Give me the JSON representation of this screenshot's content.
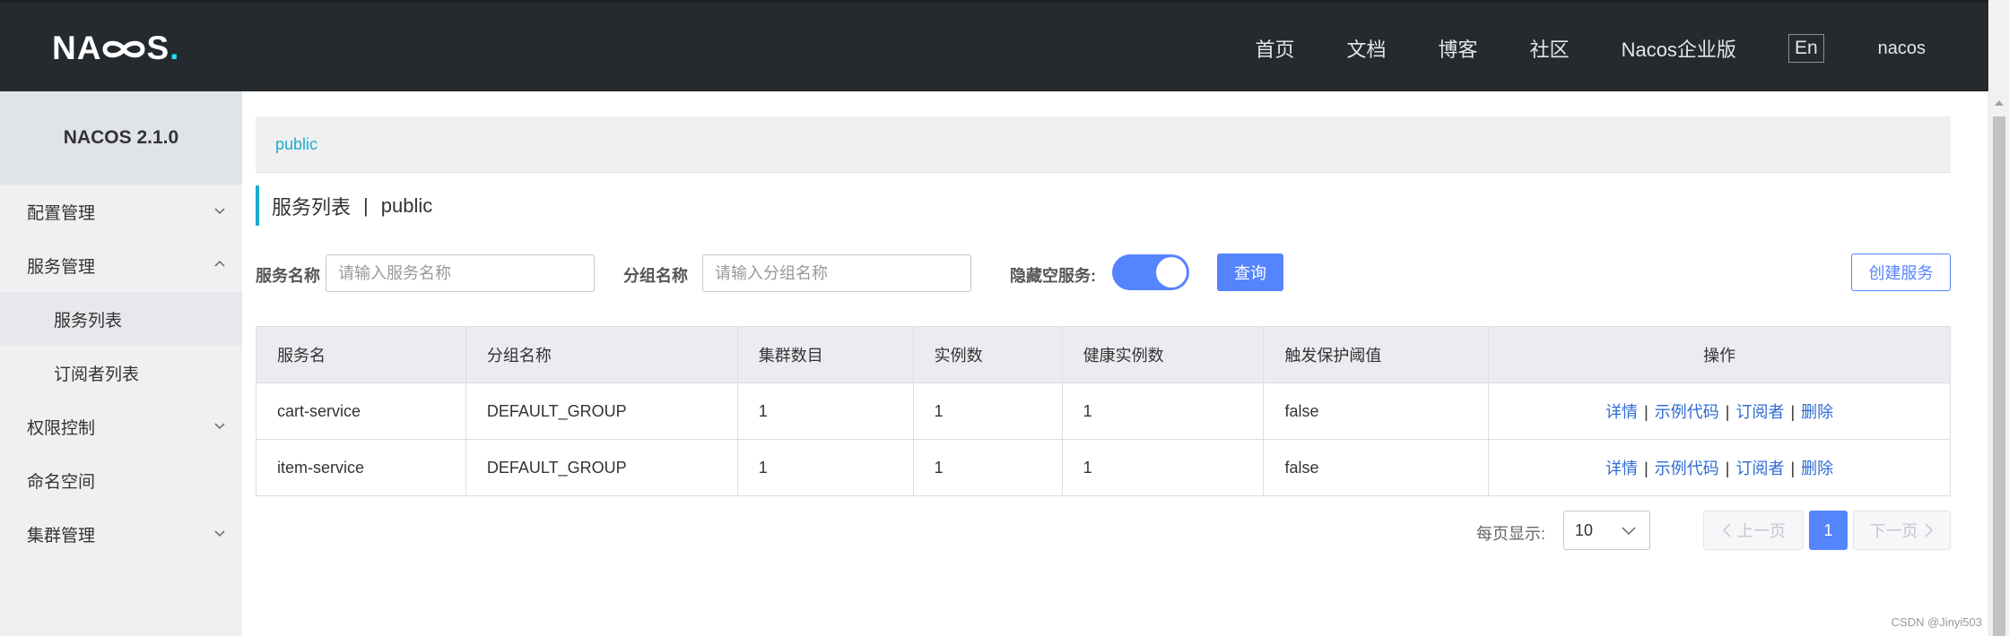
{
  "header": {
    "logo": "NACOS",
    "nav": [
      "首页",
      "文档",
      "博客",
      "社区",
      "Nacos企业版"
    ],
    "lang": "En",
    "user": "nacos"
  },
  "sidebar": {
    "version": "NACOS 2.1.0",
    "items": [
      {
        "label": "配置管理"
      },
      {
        "label": "服务管理"
      },
      {
        "label": "服务列表"
      },
      {
        "label": "订阅者列表"
      },
      {
        "label": "权限控制"
      },
      {
        "label": "命名空间"
      },
      {
        "label": "集群管理"
      }
    ]
  },
  "breadcrumb": "public",
  "page": {
    "title": "服务列表",
    "sep": "|",
    "namespace": "public"
  },
  "filter": {
    "service_label": "服务名称",
    "service_placeholder": "请输入服务名称",
    "group_label": "分组名称",
    "group_placeholder": "请输入分组名称",
    "hide_empty_label": "隐藏空服务:",
    "hide_empty_on": true,
    "query_button": "查询",
    "create_button": "创建服务"
  },
  "table": {
    "columns": [
      "服务名",
      "分组名称",
      "集群数目",
      "实例数",
      "健康实例数",
      "触发保护阈值",
      "操作"
    ],
    "rows": [
      {
        "name": "cart-service",
        "group": "DEFAULT_GROUP",
        "clusters": "1",
        "instances": "1",
        "healthy": "1",
        "threshold": "false"
      },
      {
        "name": "item-service",
        "group": "DEFAULT_GROUP",
        "clusters": "1",
        "instances": "1",
        "healthy": "1",
        "threshold": "false"
      }
    ],
    "actions": {
      "detail": "详情",
      "sample": "示例代码",
      "subscriber": "订阅者",
      "delete": "删除",
      "sep": "|"
    }
  },
  "pagination": {
    "per_page_label": "每页显示:",
    "per_page": "10",
    "prev": "上一页",
    "current": "1",
    "next": "下一页"
  },
  "watermark": "CSDN @Jinyi503",
  "colors": {
    "accent": "#5584ff",
    "link": "#2f6bd3",
    "crumb": "#1aadce",
    "topbar": "#252a2f"
  }
}
